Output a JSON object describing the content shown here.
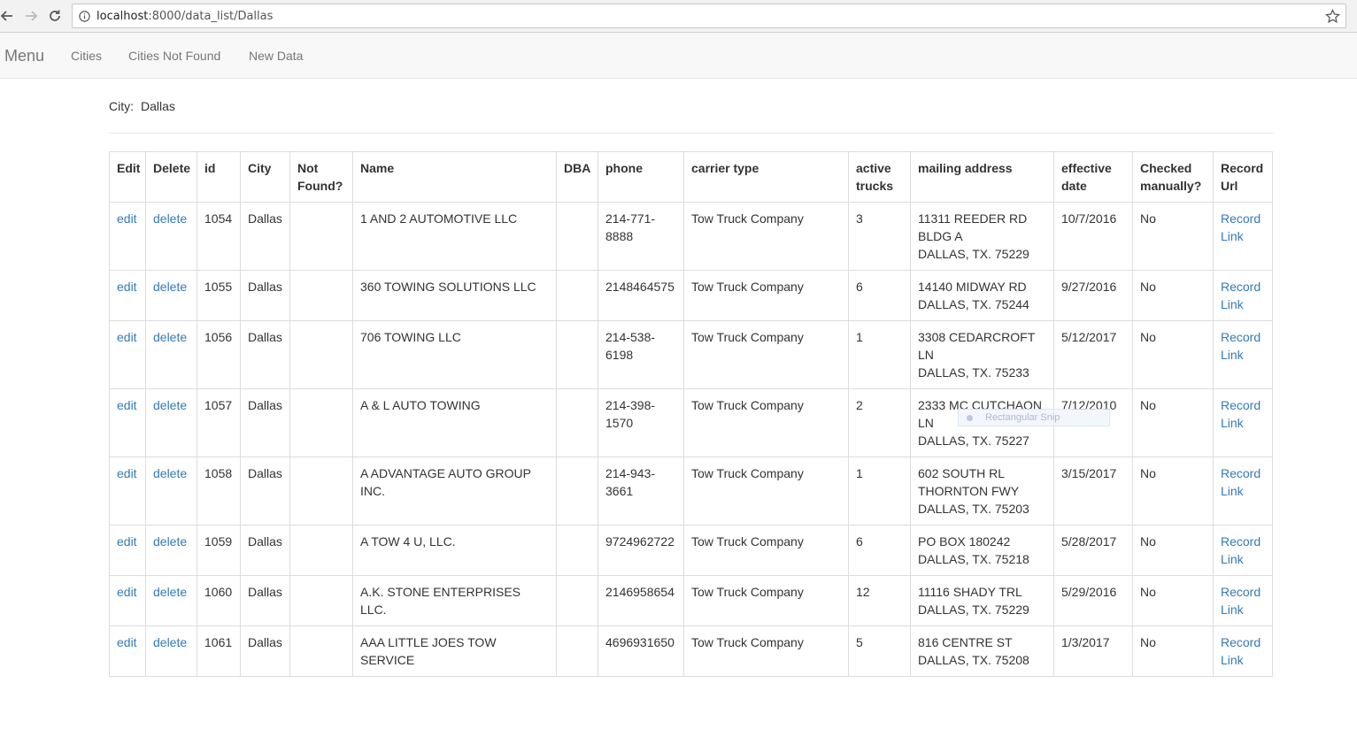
{
  "browser": {
    "url_host": "localhost",
    "url_path": ":8000/data_list/Dallas"
  },
  "navbar": {
    "brand": "Menu",
    "links": [
      "Cities",
      "Cities Not Found",
      "New Data"
    ]
  },
  "city_line": {
    "label": "City:",
    "value": "Dallas"
  },
  "table": {
    "headers": [
      "Edit",
      "Delete",
      "id",
      "City",
      "Not Found?",
      "Name",
      "DBA",
      "phone",
      "carrier type",
      "active trucks",
      "mailing address",
      "effective date",
      "Checked manually?",
      "Record Url"
    ],
    "edit_label": "edit",
    "delete_label": "delete",
    "record_link_label": "Record Link",
    "rows": [
      {
        "id": "1054",
        "city": "Dallas",
        "not_found": "",
        "name": "1 AND 2 AUTOMOTIVE LLC",
        "dba": "",
        "phone": "214-771-8888",
        "carrier_type": "Tow Truck Company",
        "active_trucks": "3",
        "address": [
          "11311 REEDER RD BLDG A",
          "DALLAS, TX. 75229"
        ],
        "effective_date": "10/7/2016",
        "checked": "No"
      },
      {
        "id": "1055",
        "city": "Dallas",
        "not_found": "",
        "name": "360 TOWING SOLUTIONS LLC",
        "dba": "",
        "phone": "2148464575",
        "carrier_type": "Tow Truck Company",
        "active_trucks": "6",
        "address": [
          "14140 MIDWAY RD",
          "DALLAS, TX. 75244"
        ],
        "effective_date": "9/27/2016",
        "checked": "No"
      },
      {
        "id": "1056",
        "city": "Dallas",
        "not_found": "",
        "name": "706 TOWING LLC",
        "dba": "",
        "phone": "214-538-6198",
        "carrier_type": "Tow Truck Company",
        "active_trucks": "1",
        "address": [
          "3308 CEDARCROFT LN",
          "DALLAS, TX. 75233"
        ],
        "effective_date": "5/12/2017",
        "checked": "No"
      },
      {
        "id": "1057",
        "city": "Dallas",
        "not_found": "",
        "name": "A & L AUTO TOWING",
        "dba": "",
        "phone": "214-398-1570",
        "carrier_type": "Tow Truck Company",
        "active_trucks": "2",
        "address": [
          "2333 MC CUTCHAON LN",
          "DALLAS, TX. 75227"
        ],
        "effective_date": "7/12/2010",
        "checked": "No"
      },
      {
        "id": "1058",
        "city": "Dallas",
        "not_found": "",
        "name": "A ADVANTAGE AUTO GROUP INC.",
        "dba": "",
        "phone": "214-943-3661",
        "carrier_type": "Tow Truck Company",
        "active_trucks": "1",
        "address": [
          "602 SOUTH RL THORNTON FWY",
          "DALLAS, TX. 75203"
        ],
        "effective_date": "3/15/2017",
        "checked": "No"
      },
      {
        "id": "1059",
        "city": "Dallas",
        "not_found": "",
        "name": "A TOW 4 U, LLC.",
        "dba": "",
        "phone": "9724962722",
        "carrier_type": "Tow Truck Company",
        "active_trucks": "6",
        "address": [
          "PO BOX 180242",
          "DALLAS, TX. 75218"
        ],
        "effective_date": "5/28/2017",
        "checked": "No"
      },
      {
        "id": "1060",
        "city": "Dallas",
        "not_found": "",
        "name": "A.K. STONE ENTERPRISES LLC.",
        "dba": "",
        "phone": "2146958654",
        "carrier_type": "Tow Truck Company",
        "active_trucks": "12",
        "address": [
          "11116 SHADY TRL",
          "DALLAS, TX. 75229"
        ],
        "effective_date": "5/29/2016",
        "checked": "No"
      },
      {
        "id": "1061",
        "city": "Dallas",
        "not_found": "",
        "name": "AAA LITTLE JOES TOW SERVICE",
        "dba": "",
        "phone": "4696931650",
        "carrier_type": "Tow Truck Company",
        "active_trucks": "5",
        "address": [
          "816 CENTRE ST",
          "DALLAS, TX. 75208"
        ],
        "effective_date": "1/3/2017",
        "checked": "No"
      }
    ]
  },
  "overlay": {
    "snip_label": "Rectangular Snip"
  },
  "icons": {
    "back": "back-arrow-icon",
    "forward": "forward-arrow-icon",
    "reload": "reload-icon",
    "info": "info-icon",
    "bookmark": "star-icon"
  },
  "colors": {
    "link": "#337ab7",
    "navbar_bg": "#f8f8f8",
    "border": "#dddddd"
  }
}
